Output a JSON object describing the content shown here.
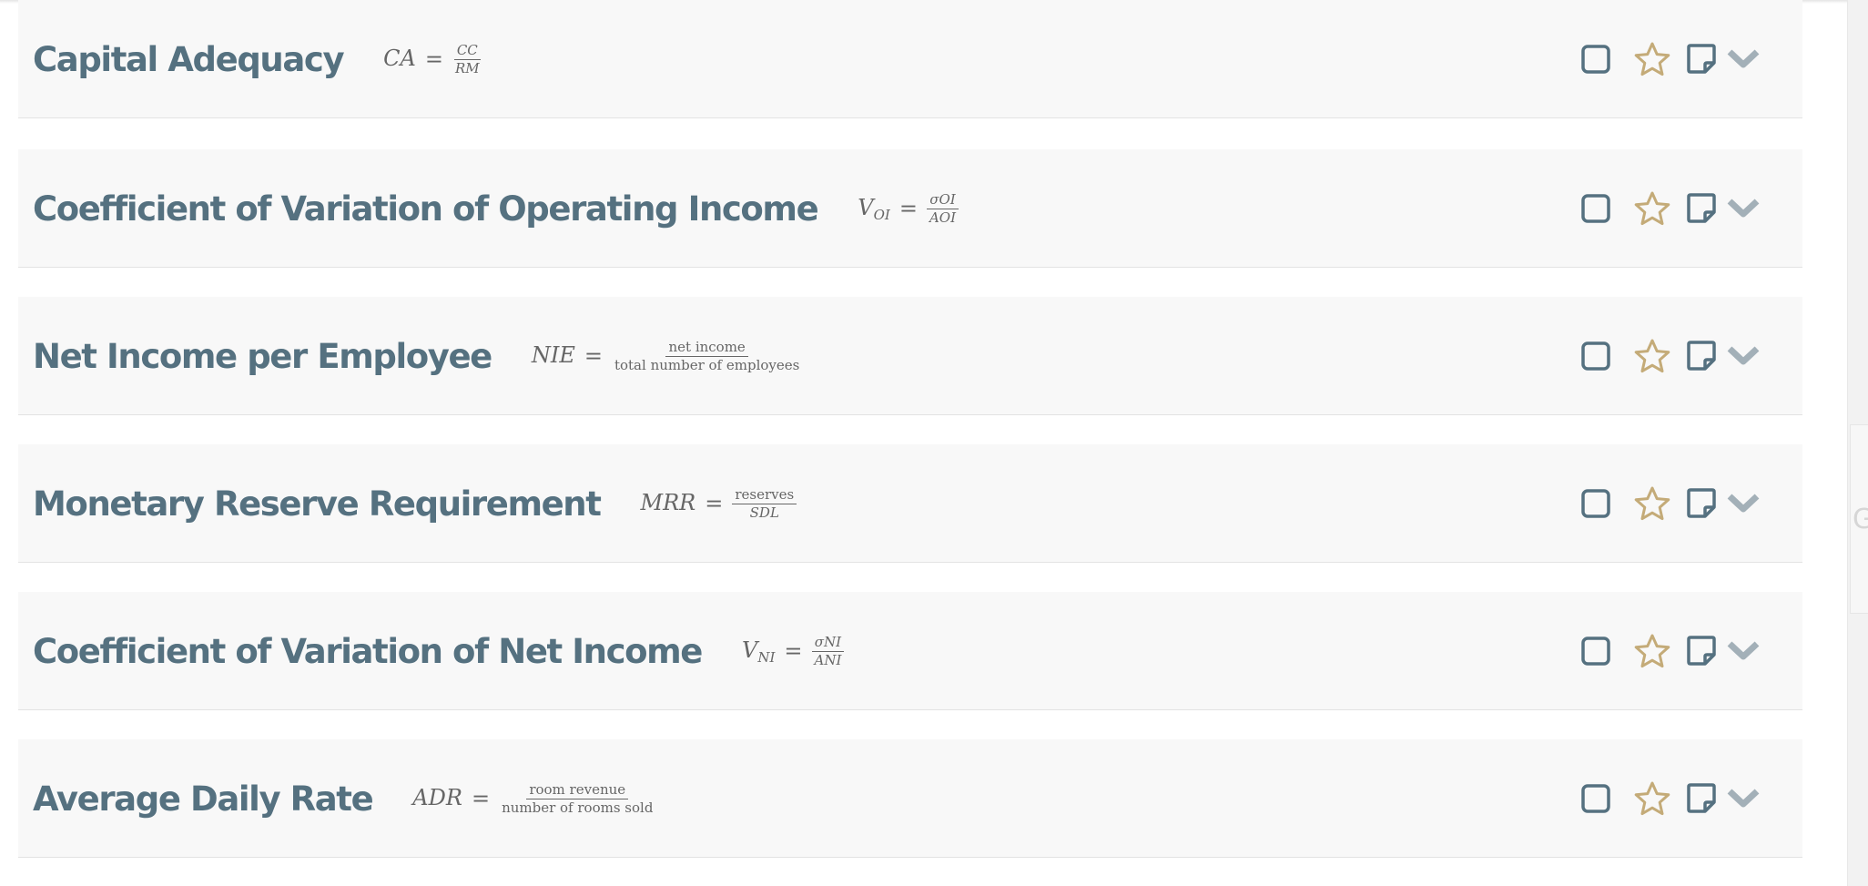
{
  "theme": {
    "title_color": "#557180",
    "formula_color": "#666666",
    "icon_color": "#557180",
    "star_color": "#c4ab78",
    "chevron_color": "#a3b0b8",
    "card_background": "#f8f8f8"
  },
  "icons": {
    "select": "checkbox-icon",
    "favorite": "star-icon",
    "note": "note-icon",
    "expand": "chevron-down-icon"
  },
  "metrics": [
    {
      "title": "Capital Adequacy",
      "formula": {
        "lhs": "CA",
        "lhs_sub": "",
        "eq": "=",
        "numerator": "CC",
        "denominator": "RM",
        "text_fraction": false
      }
    },
    {
      "title": "Coefficient of Variation of Operating Income",
      "formula": {
        "lhs": "V",
        "lhs_sub": "OI",
        "eq": "=",
        "numerator": "σOI",
        "denominator": "AOI",
        "text_fraction": false
      }
    },
    {
      "title": "Net Income per Employee",
      "formula": {
        "lhs": "NIE",
        "lhs_sub": "",
        "eq": "=",
        "numerator": "net income",
        "denominator": "total number of employees",
        "text_fraction": true
      }
    },
    {
      "title": "Monetary Reserve Requirement",
      "formula": {
        "lhs": "MRR",
        "lhs_sub": "",
        "eq": "=",
        "numerator": "reserves",
        "denominator": "SDL",
        "text_fraction": false
      }
    },
    {
      "title": "Coefficient of Variation of Net Income",
      "formula": {
        "lhs": "V",
        "lhs_sub": "NI",
        "eq": "=",
        "numerator": "σNI",
        "denominator": "ANI",
        "text_fraction": false
      }
    },
    {
      "title": "Average Daily Rate",
      "formula": {
        "lhs": "ADR",
        "lhs_sub": "",
        "eq": "=",
        "numerator": "room revenue",
        "denominator": "number of rooms sold",
        "text_fraction": true
      }
    }
  ],
  "side_panel": {
    "peek_text": "G"
  }
}
